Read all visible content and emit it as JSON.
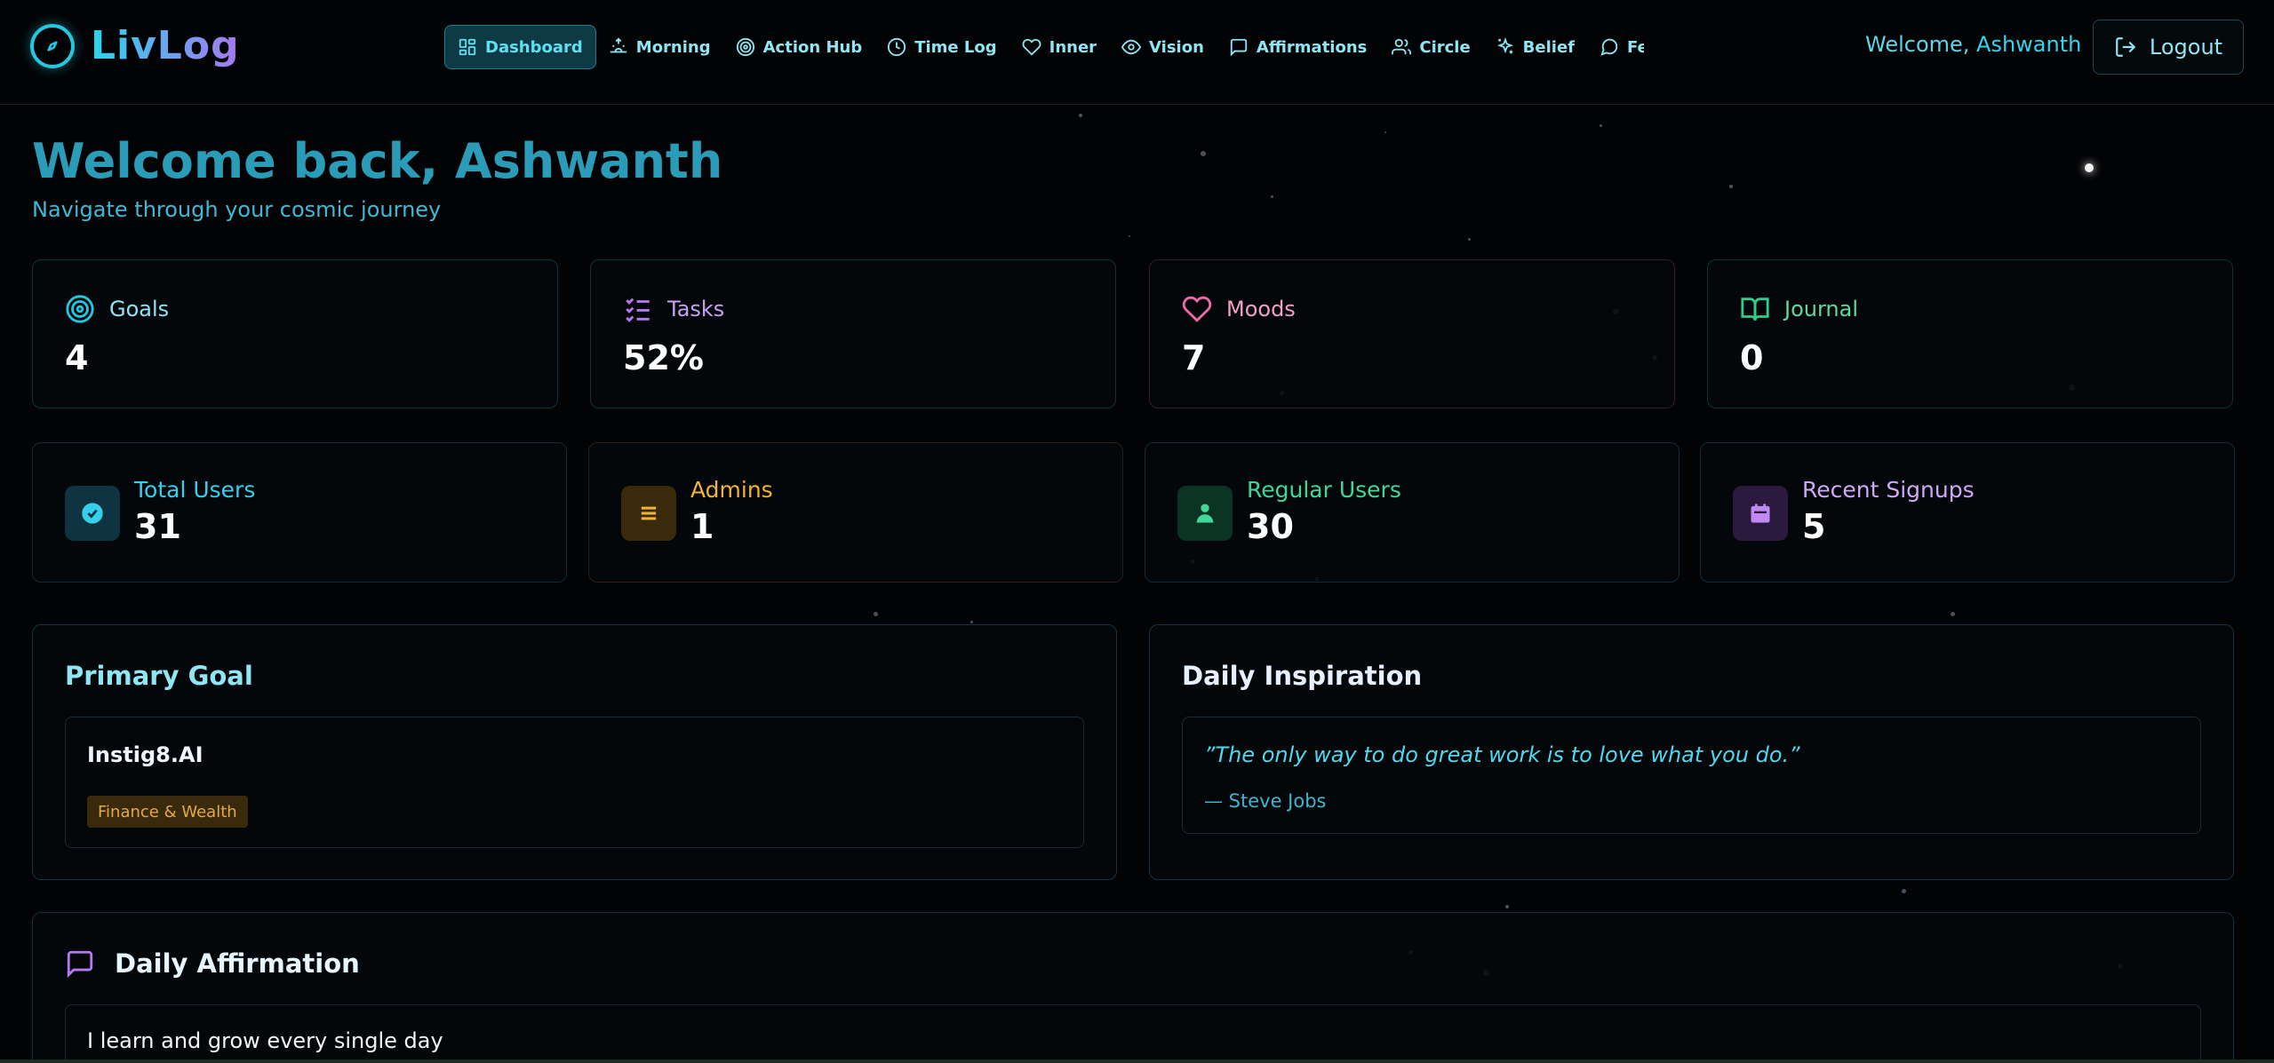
{
  "brand": {
    "name": "LivLog"
  },
  "nav": {
    "items": [
      {
        "label": "Dashboard",
        "icon": "dashboard-icon",
        "active": true
      },
      {
        "label": "Morning",
        "icon": "sunrise-icon"
      },
      {
        "label": "Action Hub",
        "icon": "target-icon"
      },
      {
        "label": "Time Log",
        "icon": "clock-icon"
      },
      {
        "label": "Inner",
        "icon": "heart-icon"
      },
      {
        "label": "Vision",
        "icon": "eye-icon"
      },
      {
        "label": "Affirmations",
        "icon": "message-icon"
      },
      {
        "label": "Circle",
        "icon": "users-icon"
      },
      {
        "label": "Belief",
        "icon": "sparkles-icon"
      },
      {
        "label": "Feedback",
        "icon": "chat-icon"
      }
    ],
    "overflow": "&"
  },
  "header": {
    "welcome_prefix": "Welcome, ",
    "username": "Ashwanth",
    "logout": "Logout"
  },
  "page": {
    "title": "Welcome back, Ashwanth",
    "subtitle": "Navigate through your cosmic journey"
  },
  "stats": [
    {
      "label": "Goals",
      "value": "4",
      "icon": "target-icon",
      "color": "#22c7e0"
    },
    {
      "label": "Tasks",
      "value": "52%",
      "icon": "checklist-icon",
      "color": "#b57bee"
    },
    {
      "label": "Moods",
      "value": "7",
      "icon": "heart-icon",
      "color": "#f06aa8"
    },
    {
      "label": "Journal",
      "value": "0",
      "icon": "book-icon",
      "color": "#2fcf8a"
    }
  ],
  "users": [
    {
      "label": "Total Users",
      "value": "31",
      "icon": "badge-check-icon",
      "color": "#36d0ec",
      "bg": "#0d3440"
    },
    {
      "label": "Admins",
      "value": "1",
      "icon": "menu-icon",
      "color": "#f0b437",
      "bg": "#3a2a0c"
    },
    {
      "label": "Regular Users",
      "value": "30",
      "icon": "user-icon",
      "color": "#3fd89a",
      "bg": "#0b3425"
    },
    {
      "label": "Recent Signups",
      "value": "5",
      "icon": "calendar-icon",
      "color": "#c08af2",
      "bg": "#2b1a3d"
    }
  ],
  "primary_goal": {
    "title": "Primary Goal",
    "name": "Instig8.AI",
    "tag": "Finance & Wealth"
  },
  "inspiration": {
    "title": "Daily Inspiration",
    "quote": "”The only way to do great work is to love what you do.”",
    "author": "— Steve Jobs"
  },
  "affirmation": {
    "title": "Daily Affirmation",
    "text": "I learn and grow every single day"
  }
}
